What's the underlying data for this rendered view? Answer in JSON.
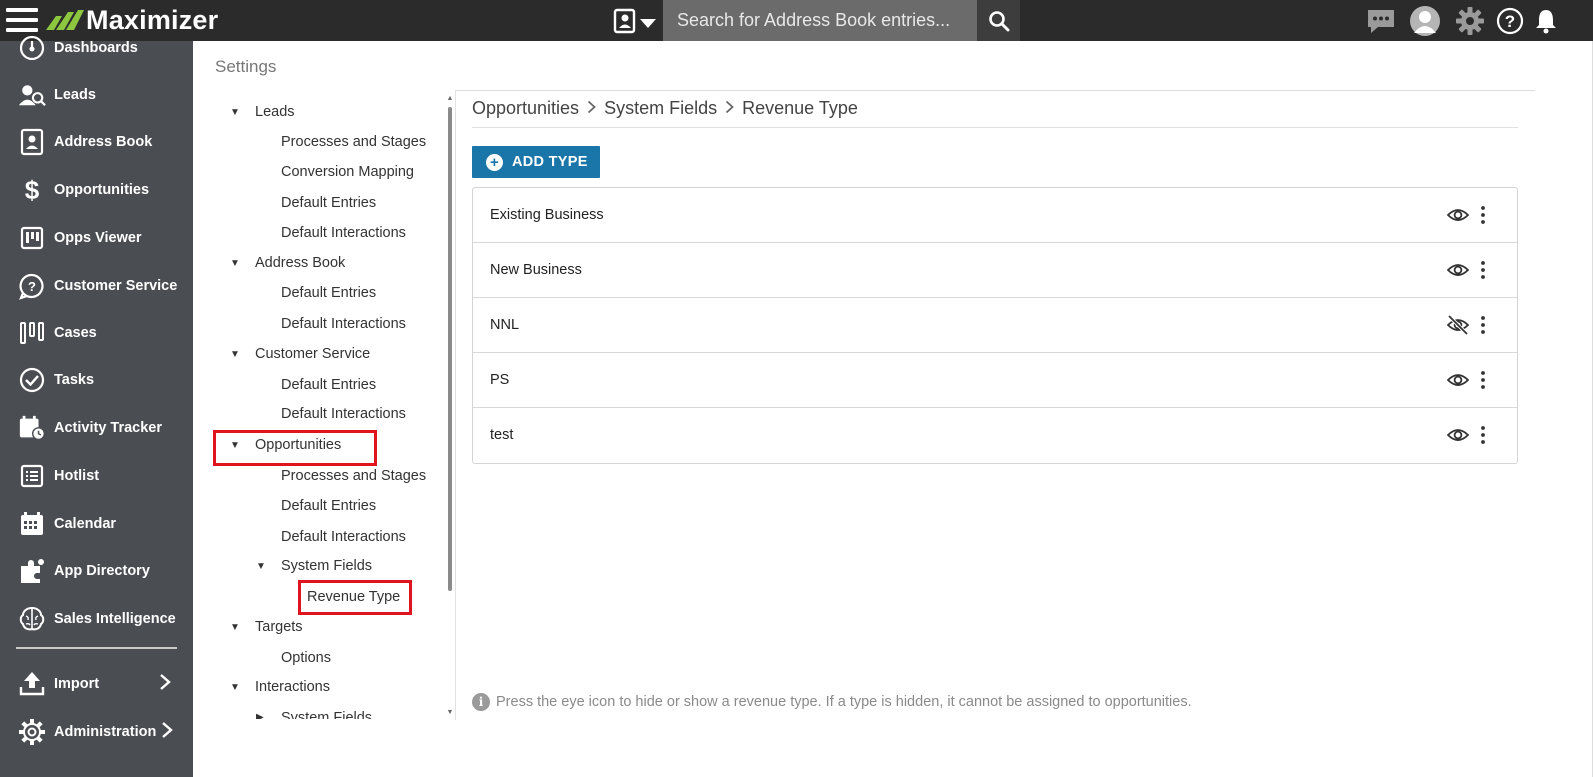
{
  "topbar": {
    "app_name": "Maximizer",
    "search_placeholder": "Search for Address Book entries...",
    "icons": [
      "menu-icon",
      "address-book-selector-icon",
      "search-icon",
      "chat-icon",
      "user-avatar-icon",
      "gear-icon",
      "help-icon",
      "bell-icon"
    ]
  },
  "sidebar": {
    "items": [
      {
        "label": "Dashboards",
        "icon": "dashboard-icon"
      },
      {
        "label": "Leads",
        "icon": "leads-icon"
      },
      {
        "label": "Address Book",
        "icon": "address-book-icon"
      },
      {
        "label": "Opportunities",
        "icon": "dollar-icon"
      },
      {
        "label": "Opps Viewer",
        "icon": "kanban-icon"
      },
      {
        "label": "Customer Service",
        "icon": "question-bubble-icon"
      },
      {
        "label": "Cases",
        "icon": "cases-icon"
      },
      {
        "label": "Tasks",
        "icon": "check-circle-icon"
      },
      {
        "label": "Activity Tracker",
        "icon": "calendar-clock-icon"
      },
      {
        "label": "Hotlist",
        "icon": "list-icon"
      },
      {
        "label": "Calendar",
        "icon": "calendar-icon"
      },
      {
        "label": "App Directory",
        "icon": "puzzle-icon"
      },
      {
        "label": "Sales Intelligence",
        "icon": "brain-icon"
      },
      {
        "label": "Import",
        "icon": "upload-icon",
        "chevron": "›"
      },
      {
        "label": "Administration",
        "icon": "gear-outline-icon",
        "chevron": "›"
      }
    ]
  },
  "settings": {
    "title": "Settings",
    "tree": [
      {
        "label": "Leads",
        "level": 0,
        "expanded": true
      },
      {
        "label": "Processes and Stages",
        "level": 1
      },
      {
        "label": "Conversion Mapping",
        "level": 1
      },
      {
        "label": "Default Entries",
        "level": 1
      },
      {
        "label": "Default Interactions",
        "level": 1
      },
      {
        "label": "Address Book",
        "level": 0,
        "expanded": true
      },
      {
        "label": "Default Entries",
        "level": 1
      },
      {
        "label": "Default Interactions",
        "level": 1
      },
      {
        "label": "Customer Service",
        "level": 0,
        "expanded": true
      },
      {
        "label": "Default Entries",
        "level": 1
      },
      {
        "label": "Default Interactions",
        "level": 1
      },
      {
        "label": "Opportunities",
        "level": 0,
        "expanded": true
      },
      {
        "label": "Processes and Stages",
        "level": 1
      },
      {
        "label": "Default Entries",
        "level": 1
      },
      {
        "label": "Default Interactions",
        "level": 1
      },
      {
        "label": "System Fields",
        "level": 1,
        "expanded": true
      },
      {
        "label": "Revenue Type",
        "level": 2,
        "selected": true
      },
      {
        "label": "Targets",
        "level": 0,
        "expanded": true
      },
      {
        "label": "Options",
        "level": 1
      },
      {
        "label": "Interactions",
        "level": 0,
        "expanded": true
      },
      {
        "label": "System Fields",
        "level": 1,
        "collapsed": true
      }
    ]
  },
  "content": {
    "breadcrumb": [
      "Opportunities",
      "System Fields",
      "Revenue Type"
    ],
    "breadcrumb_separator": ">",
    "add_button_label": "ADD TYPE",
    "revenue_types": [
      {
        "name": "Existing Business",
        "visible": true
      },
      {
        "name": "New Business",
        "visible": true
      },
      {
        "name": "NNL",
        "visible": false
      },
      {
        "name": "PS",
        "visible": true
      },
      {
        "name": "test",
        "visible": true
      }
    ],
    "hint_text": "Press the eye icon to hide or show a revenue type. If a type is hidden, it cannot be assigned to opportunities."
  },
  "colors": {
    "topbar_bg": "#2b2b2b",
    "sidebar_bg": "#4a4d52",
    "accent_blue": "#1a76a8",
    "logo_green": "#8dc63f",
    "highlight_red": "#e0141e"
  }
}
